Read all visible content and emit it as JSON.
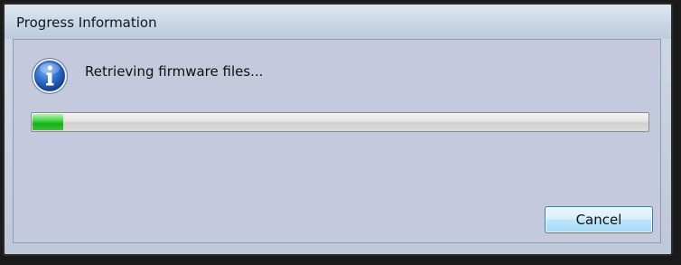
{
  "window": {
    "title": "Progress Information"
  },
  "dialog": {
    "icon": "info-icon",
    "message": "Retrieving firmware files...",
    "progress_fraction": 0.05,
    "cancel_label": "Cancel"
  },
  "colors": {
    "progress_green": "#22b522",
    "client_background": "#c5c9dd",
    "button_border": "#3c7fb1"
  }
}
